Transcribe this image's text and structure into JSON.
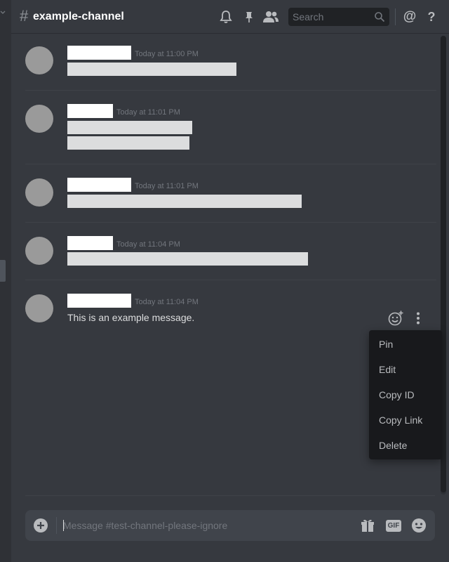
{
  "header": {
    "hash": "#",
    "channel_name": "example-channel",
    "search_placeholder": "Search",
    "icons": [
      "bell-icon",
      "pin-icon",
      "members-icon",
      "search-icon",
      "at-icon",
      "help-icon"
    ],
    "at_symbol": "@",
    "help_symbol": "?"
  },
  "messages": [
    {
      "timestamp": "Today at 11:00 PM",
      "lines": 1
    },
    {
      "timestamp": "Today at 11:01 PM",
      "lines": 2
    },
    {
      "timestamp": "Today at 11:01 PM",
      "lines": 1
    },
    {
      "timestamp": "Today at 11:04 PM",
      "lines": 1
    },
    {
      "timestamp": "Today at 11:04 PM",
      "text": "This is an example message."
    }
  ],
  "context_menu": {
    "items": [
      "Pin",
      "Edit",
      "Copy ID",
      "Copy Link",
      "Delete"
    ]
  },
  "composer": {
    "placeholder": "Message #test-channel-please-ignore",
    "gif_label": "GIF",
    "icons": [
      "add-icon",
      "gift-icon",
      "gif-icon",
      "emoji-icon"
    ]
  },
  "colors": {
    "background": "#36393f",
    "sidebar": "#2f3136",
    "context_menu": "#18191c",
    "composer": "#40444b",
    "avatar": "#9a9a9a",
    "text": "#dcddde",
    "muted": "#72767d"
  }
}
